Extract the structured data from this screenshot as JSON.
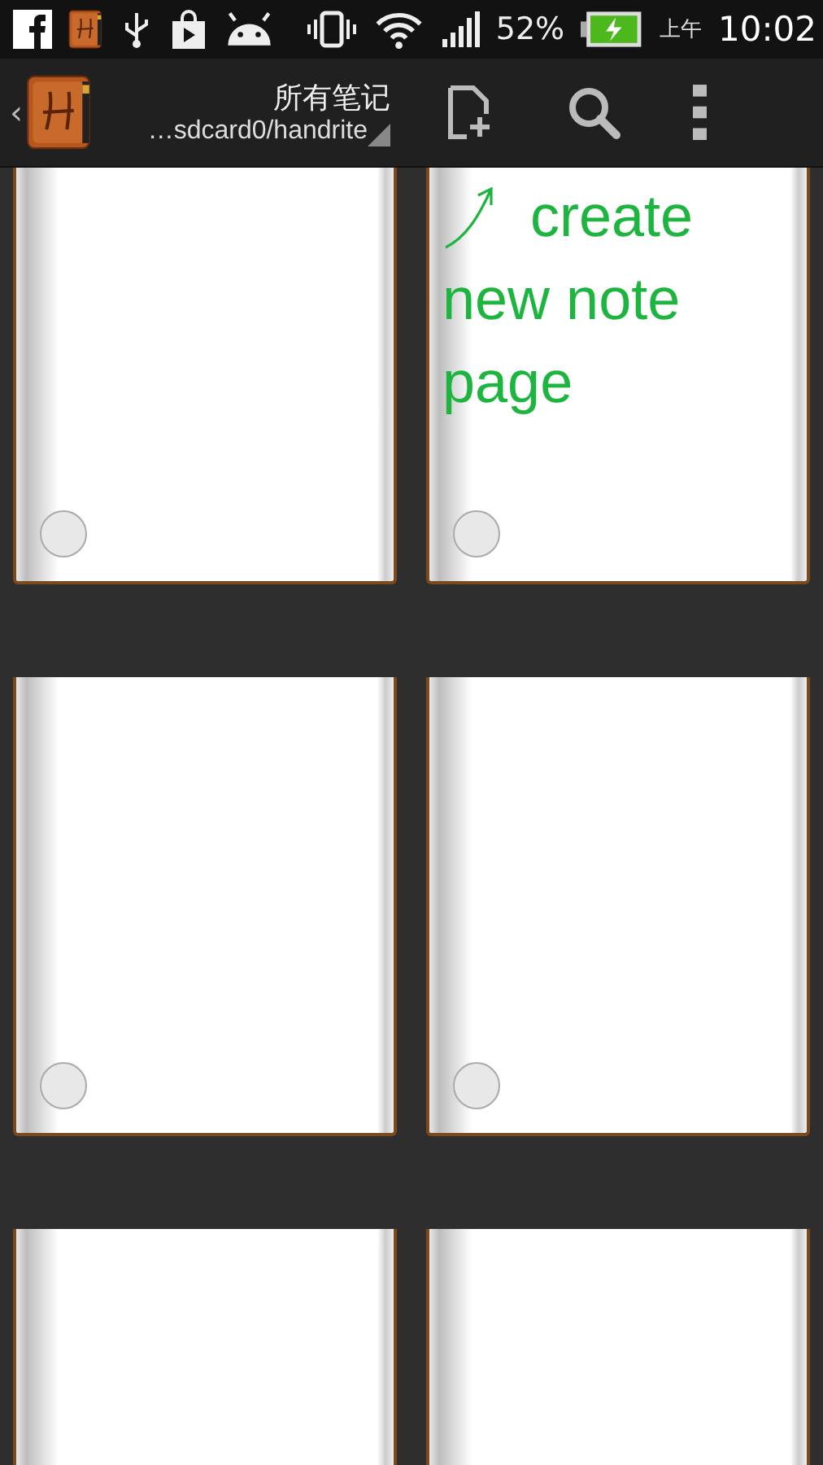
{
  "status_bar": {
    "battery_percent": "52%",
    "am_pm": "上午",
    "time": "10:02"
  },
  "action_bar": {
    "back": "‹",
    "title": "所有笔记",
    "path": "…sdcard0/handrite"
  },
  "notes": [
    {
      "kind": "blank"
    },
    {
      "kind": "annotated",
      "lines": [
        "create",
        "new note page"
      ]
    },
    {
      "kind": "blank"
    },
    {
      "kind": "blank"
    },
    {
      "kind": "cut_off"
    },
    {
      "kind": "cut_off"
    }
  ]
}
